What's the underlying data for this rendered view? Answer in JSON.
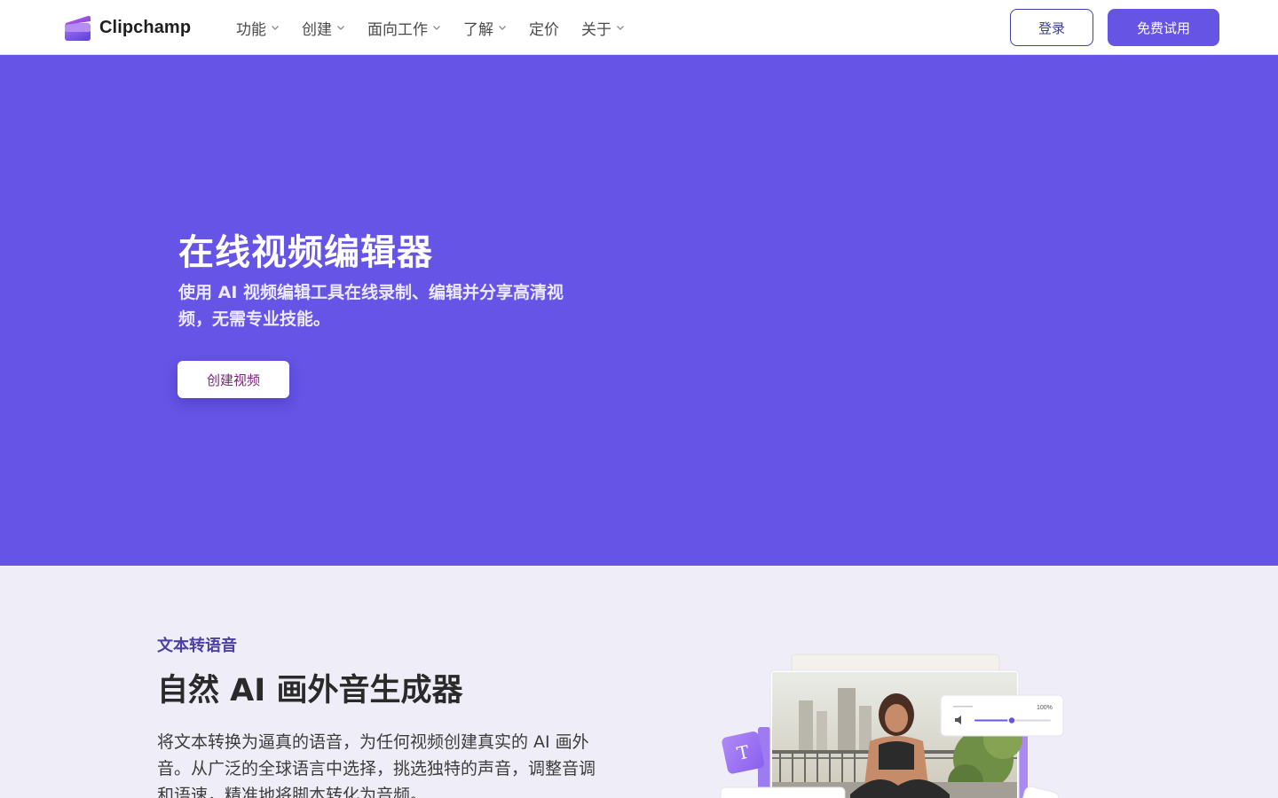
{
  "header": {
    "brand_name": "Clipchamp",
    "nav": [
      {
        "label": "功能",
        "has_dropdown": true
      },
      {
        "label": "创建",
        "has_dropdown": true
      },
      {
        "label": "面向工作",
        "has_dropdown": true
      },
      {
        "label": "了解",
        "has_dropdown": true
      },
      {
        "label": "定价",
        "has_dropdown": false
      },
      {
        "label": "关于",
        "has_dropdown": true
      }
    ],
    "login_label": "登录",
    "trial_label": "免费试用"
  },
  "hero": {
    "title": "在线视频编辑器",
    "subtitle": "使用 AI 视频编辑工具在线录制、编辑并分享高清视频，无需专业技能。",
    "cta_label": "创建视频"
  },
  "feature": {
    "eyebrow": "文本转语音",
    "title": "自然 AI 画外音生成器",
    "description": "将文本转换为逼真的语音，为任何视频创建真实的 AI 画外音。从广泛的全球语言中选择，挑选独特的声音，调整音调和语速，精准地将脚本转化为音频。",
    "illustration": {
      "volume_readout": "100%",
      "text_tile_glyph": "T"
    }
  },
  "colors": {
    "hero_bg": "#6554e5",
    "accent": "#6654e4",
    "feature_bg": "#efeef8",
    "eyebrow": "#4b3fa6"
  }
}
